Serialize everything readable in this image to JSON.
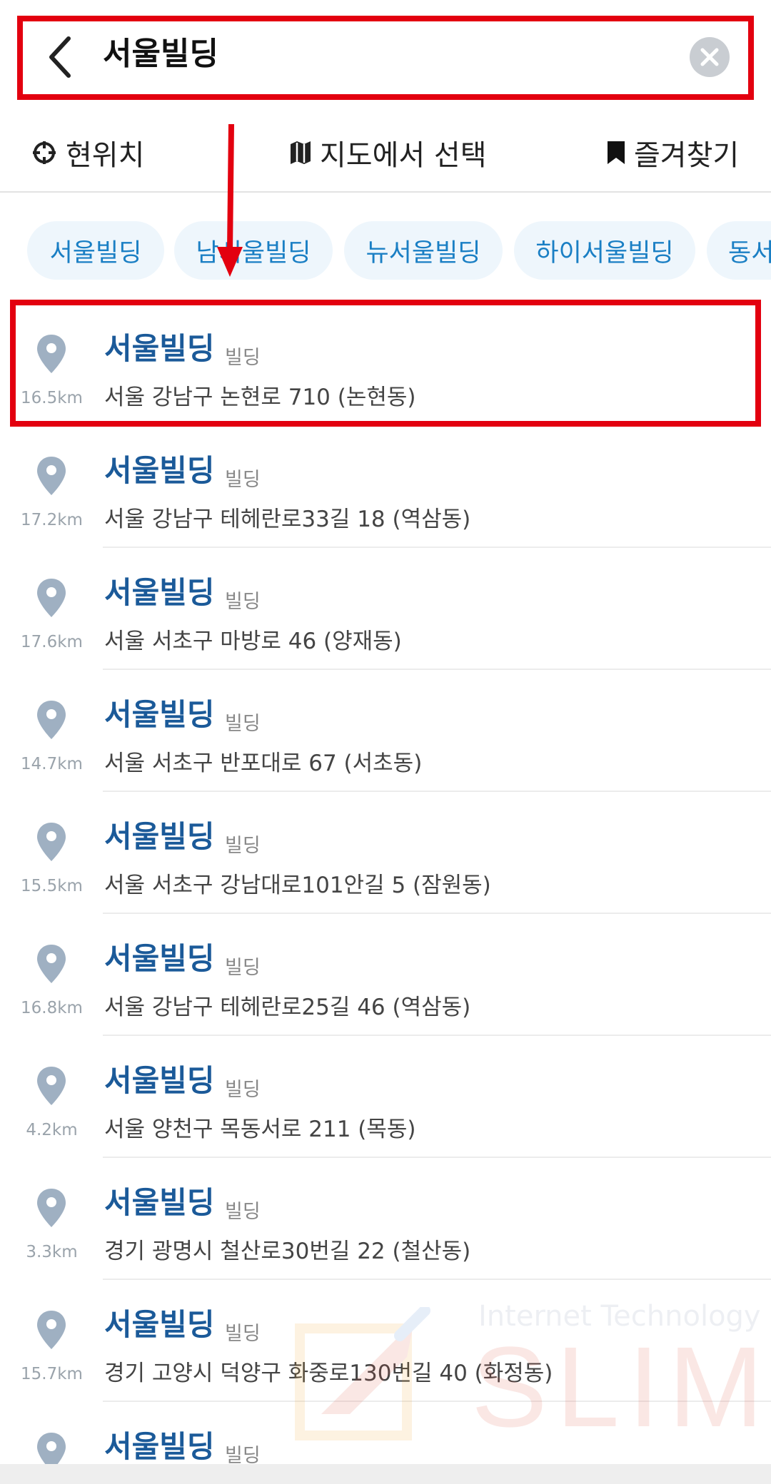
{
  "search": {
    "query": "서울빌딩"
  },
  "options": {
    "current_location": "현위치",
    "select_on_map": "지도에서 선택",
    "favorites": "즐겨찾기"
  },
  "suggestions": [
    "서울빌딩",
    "남서울빌딩",
    "뉴서울빌딩",
    "하이서울빌딩",
    "동서"
  ],
  "results": [
    {
      "name": "서울빌딩",
      "category": "빌딩",
      "distance": "16.5km",
      "address": "서울 강남구 논현로 710 (논현동)"
    },
    {
      "name": "서울빌딩",
      "category": "빌딩",
      "distance": "17.2km",
      "address": "서울 강남구 테헤란로33길 18 (역삼동)"
    },
    {
      "name": "서울빌딩",
      "category": "빌딩",
      "distance": "17.6km",
      "address": "서울 서초구 마방로 46 (양재동)"
    },
    {
      "name": "서울빌딩",
      "category": "빌딩",
      "distance": "14.7km",
      "address": "서울 서초구 반포대로 67 (서초동)"
    },
    {
      "name": "서울빌딩",
      "category": "빌딩",
      "distance": "15.5km",
      "address": "서울 서초구 강남대로101안길 5 (잠원동)"
    },
    {
      "name": "서울빌딩",
      "category": "빌딩",
      "distance": "16.8km",
      "address": "서울 강남구 테헤란로25길 46 (역삼동)"
    },
    {
      "name": "서울빌딩",
      "category": "빌딩",
      "distance": "4.2km",
      "address": "서울 양천구 목동서로 211 (목동)"
    },
    {
      "name": "서울빌딩",
      "category": "빌딩",
      "distance": "3.3km",
      "address": "경기 광명시 철산로30번길 22 (철산동)"
    },
    {
      "name": "서울빌딩",
      "category": "빌딩",
      "distance": "15.7km",
      "address": "경기 고양시 덕양구 화중로130번길 40 (화정동)"
    },
    {
      "name": "서울빌딩",
      "category": "빌딩",
      "distance": "",
      "address": ""
    }
  ],
  "watermark": {
    "subtitle": "Internet Technology",
    "brand": "SLIM"
  },
  "colors": {
    "highlight": "#e3000f",
    "result_title": "#1b5a99",
    "chip_text": "#1a7fc4",
    "chip_bg": "#eef6fc",
    "pin": "#9fb0c2"
  },
  "icons": {
    "back": "chevron-left-icon",
    "clear": "close-circle-icon",
    "current_location": "crosshair-icon",
    "map": "map-icon",
    "favorites": "bookmark-icon",
    "result_pin": "map-pin-icon"
  }
}
